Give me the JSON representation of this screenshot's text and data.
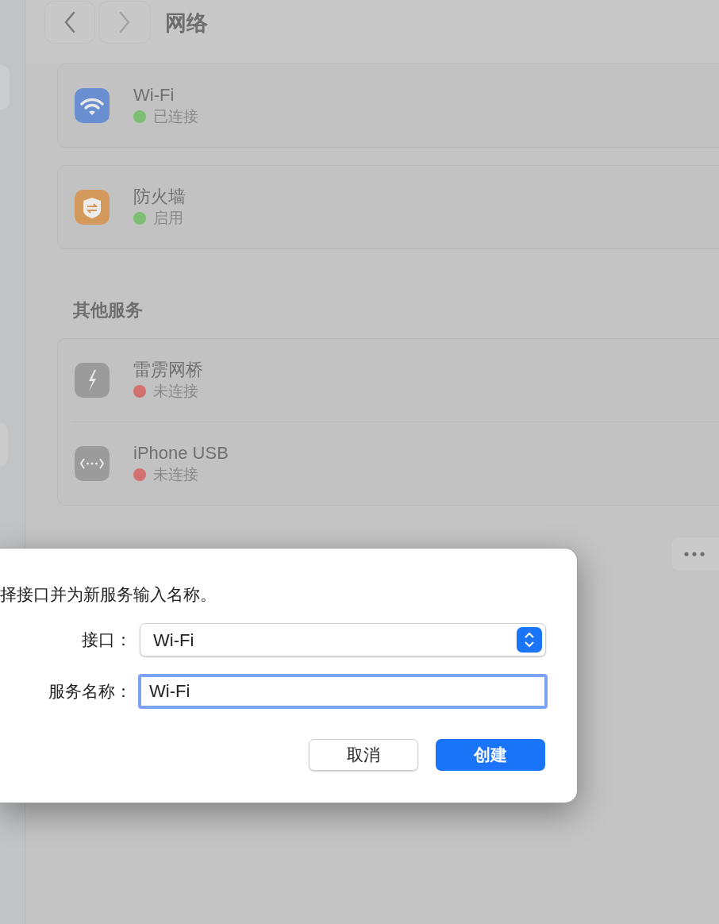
{
  "window": {
    "title": "网络"
  },
  "services": [
    {
      "kind": "wifi",
      "name": "Wi-Fi",
      "status": "已连接",
      "color": "#7dbf72"
    },
    {
      "kind": "firewall",
      "name": "防火墙",
      "status": "启用",
      "color": "#7dbf72"
    }
  ],
  "other_services": {
    "heading": "其他服务",
    "items": [
      {
        "kind": "thunderbolt",
        "name": "雷雳网桥",
        "status": "未连接",
        "color": "#d37070"
      },
      {
        "kind": "usb",
        "name": "iPhone USB",
        "status": "未连接",
        "color": "#d37070"
      }
    ]
  },
  "dialog": {
    "message": "择接口并为新服务输入名称。",
    "fields": [
      {
        "kind": "select",
        "label": "接口：",
        "value": "Wi-Fi",
        "focused": false
      },
      {
        "kind": "text",
        "label": "服务名称：",
        "value": "Wi-Fi",
        "focused": true
      }
    ],
    "buttons": [
      {
        "label": "取消",
        "default": false
      },
      {
        "label": "创建",
        "default": true
      }
    ]
  }
}
